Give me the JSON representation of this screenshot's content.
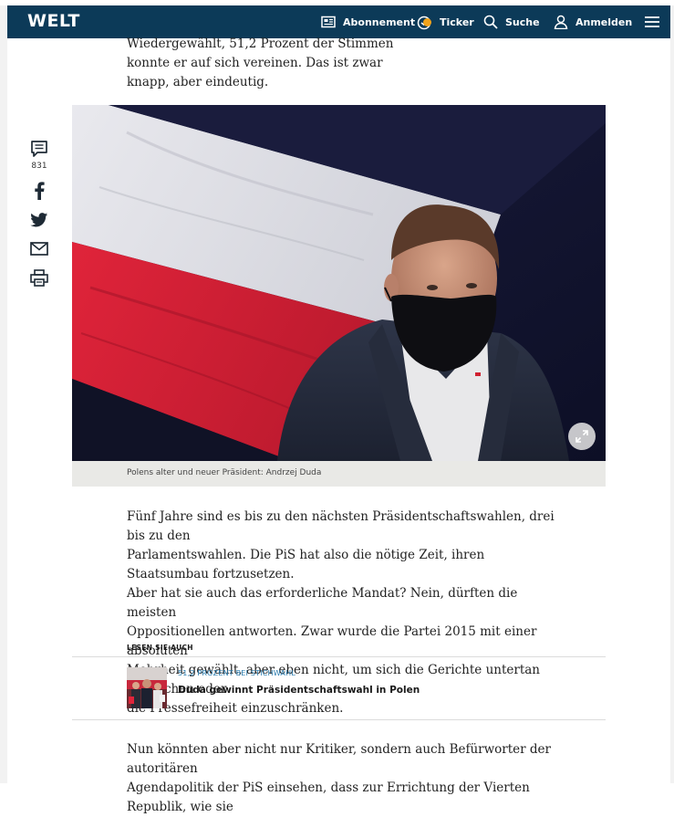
{
  "header": {
    "logo": "WELT",
    "nav": {
      "abo_label": "Abonnement",
      "ticker_label": "Ticker",
      "ticker_badge": "6",
      "suche_label": "Suche",
      "login_label": "Anmelden"
    },
    "colors": {
      "bar": "#0c3a58",
      "ticker_badge": "#f0a21a"
    }
  },
  "share": {
    "comment_count": "831",
    "icons": [
      "comment-icon",
      "facebook-icon",
      "twitter-icon",
      "mail-icon",
      "print-icon"
    ]
  },
  "article": {
    "para_top_line1": "Wiedergewählt, 51,2 Prozent der Stimmen",
    "para_top_line2": "konnte er auf sich vereinen. Das ist zwar",
    "para_top_line3": "knapp, aber eindeutig.",
    "image_caption": "Polens alter und neuer Präsident: Andrzej Duda",
    "para_mid_line1": "Fünf Jahre sind es bis zu den nächsten Präsidentschaftswahlen, drei bis zu den",
    "para_mid_line2": "Parlamentswahlen. Die PiS hat also die nötige Zeit, ihren Staatsumbau fortzusetzen.",
    "para_mid_line3": "Aber hat sie auch das erforderliche Mandat? Nein, dürften die meisten",
    "para_mid_line4": "Oppositionellen antworten. Zwar wurde die Partei 2015 mit einer absoluten",
    "para_mid_line5": "Mehrheit gewählt, aber eben nicht, um sich die Gerichte untertan zu machen oder",
    "para_mid_line6": "die Pressefreiheit einzuschränken.",
    "para_bottom_line1": "Nun könnten aber nicht nur Kritiker, sondern auch Befürworter der autoritären",
    "para_bottom_line2": "Agendapolitik der PiS einsehen, dass zur Errichtung der Vierten Republik, wie sie"
  },
  "lesen_sie_auch": {
    "heading": "LESEN SIE AUCH",
    "kicker": "51,2 PROZENT BEI STICHWAHL",
    "title": "Duda gewinnt Präsidentschaftswahl in Polen"
  }
}
